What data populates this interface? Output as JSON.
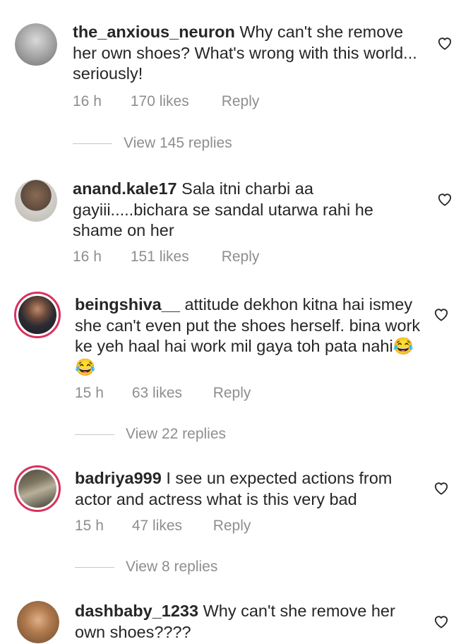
{
  "comments": [
    {
      "username": "the_anxious_neuron",
      "text": "Why can't she remove her own shoes? What's wrong with this world... seriously!",
      "time": "16 h",
      "likes": "170 likes",
      "reply": "Reply",
      "view_replies": "View 145 replies"
    },
    {
      "username": "anand.kale17",
      "text": "Sala itni charbi aa gayiii.....bichara se sandal utarwa rahi he shame on her",
      "time": "16 h",
      "likes": "151 likes",
      "reply": "Reply"
    },
    {
      "username": "beingshiva__",
      "text": "attitude dekhon kitna hai ismey she can't even put the shoes herself. bina work ke yeh haal hai work mil gaya toh pata nahi😂😂",
      "time": "15 h",
      "likes": "63 likes",
      "reply": "Reply",
      "view_replies": "View 22 replies"
    },
    {
      "username": "badriya999",
      "text": "I see un expected actions from actor and actress what is this very bad",
      "time": "15 h",
      "likes": "47 likes",
      "reply": "Reply",
      "view_replies": "View 8 replies"
    },
    {
      "username": "dashbaby_1233",
      "text": "Why can't she remove her own shoes????"
    }
  ],
  "icons": {
    "like": "heart-outline-icon"
  },
  "colors": {
    "story_ring": "#d8325e",
    "meta_text": "#8e8e8e",
    "text": "#262626"
  }
}
